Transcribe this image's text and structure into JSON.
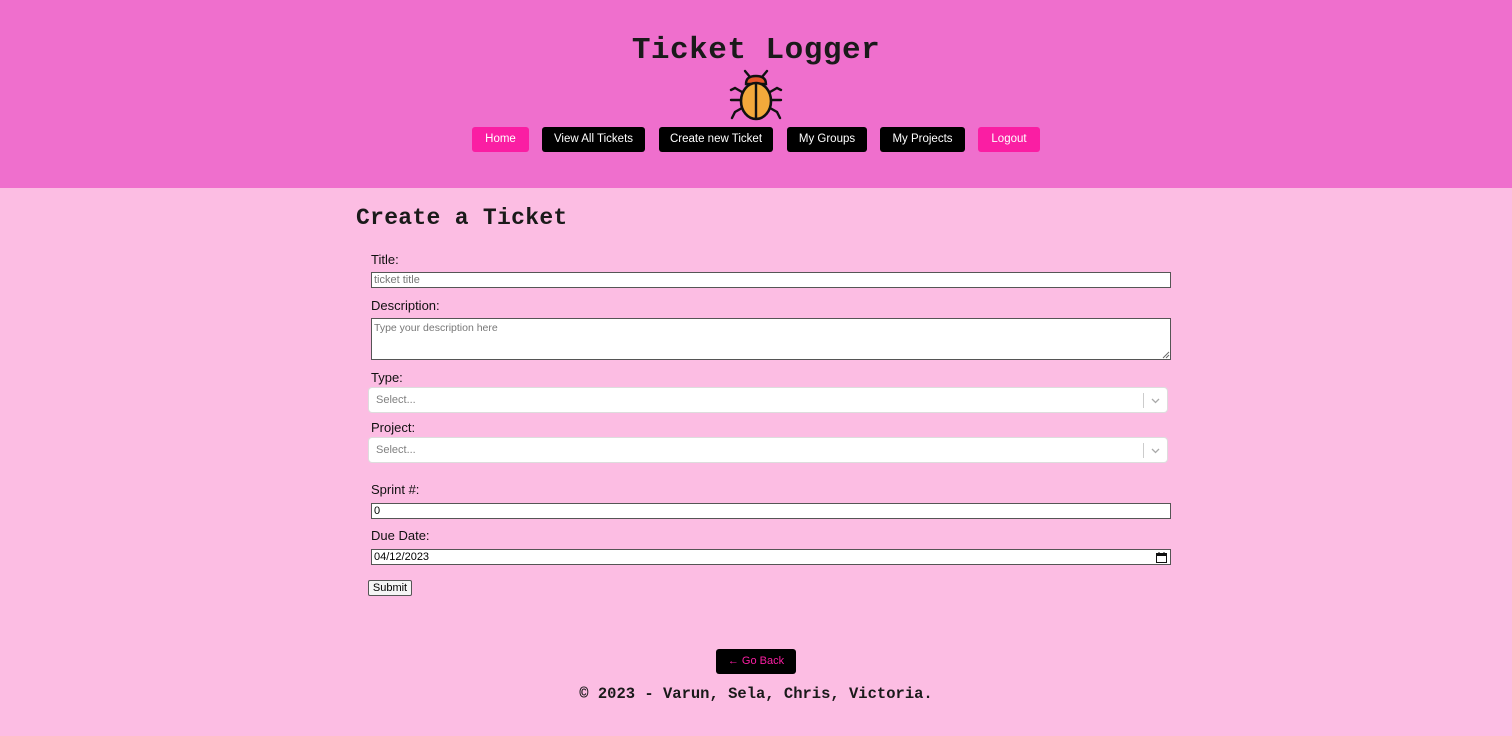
{
  "header": {
    "title": "Ticket Logger",
    "logo_icon": "bug-icon",
    "nav": [
      {
        "label": "Home",
        "color": "#fa1ea3"
      },
      {
        "label": "View All Tickets",
        "color": "#000000"
      },
      {
        "label": "Create new Ticket",
        "color": "#000000"
      },
      {
        "label": "My Groups",
        "color": "#000000"
      },
      {
        "label": "My Projects",
        "color": "#000000"
      },
      {
        "label": "Logout",
        "color": "#fa1ea3"
      }
    ]
  },
  "form": {
    "heading": "Create a Ticket",
    "title_label": "Title:",
    "title_placeholder": "ticket title",
    "description_label": "Description:",
    "description_placeholder": "Type your description here",
    "type_label": "Type:",
    "type_placeholder": "Select...",
    "project_label": "Project:",
    "project_placeholder": "Select...",
    "sprint_label": "Sprint #:",
    "sprint_value": "0",
    "due_date_label": "Due Date:",
    "due_date_value": "04/12/2023",
    "submit_label": "Submit"
  },
  "back_button": "← Go Back",
  "footer": "© 2023 - Varun, Sela, Chris, Victoria.",
  "colors": {
    "header_bg": "#ef6fcd",
    "page_bg": "#fcbde3",
    "accent_pink": "#fa1ea3"
  }
}
